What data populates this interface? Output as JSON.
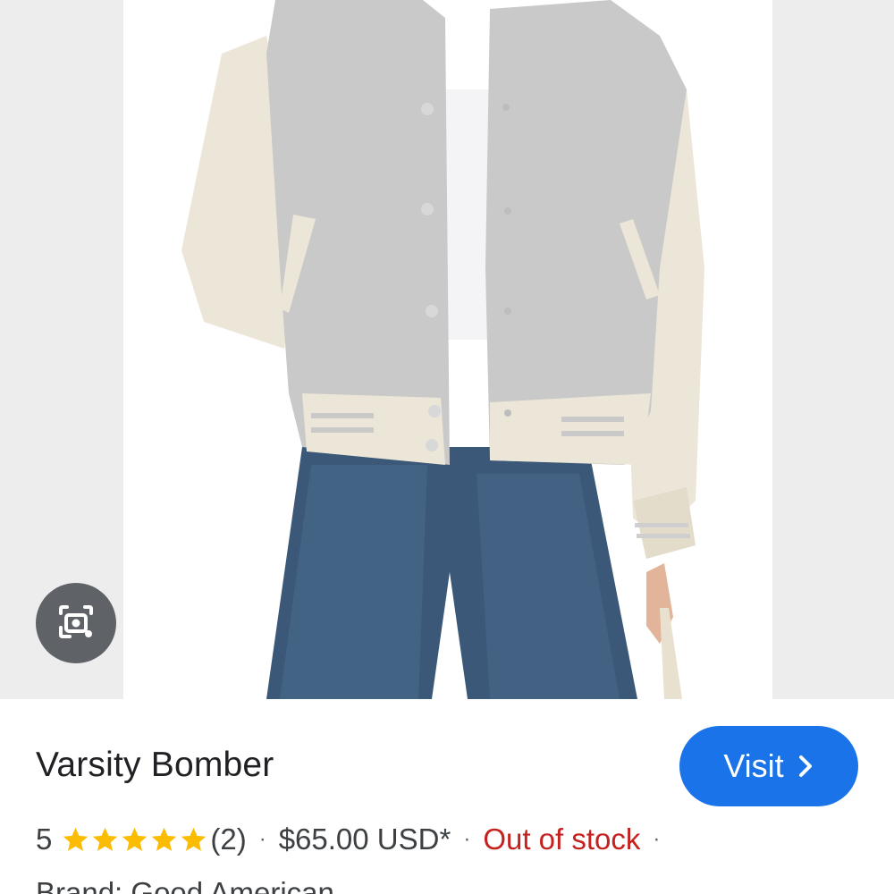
{
  "product": {
    "title": "Varsity Bomber",
    "rating": "5",
    "stars_filled": 5,
    "stars_total": 5,
    "review_count": "(2)",
    "price": "$65.00 USD*",
    "stock_status": "Out of stock",
    "separator": "·",
    "brand_line": "Brand: Good American"
  },
  "actions": {
    "visit_label": "Visit",
    "visit_icon": "chevron-right-icon",
    "lens_icon": "camera-search-icon"
  },
  "image": {
    "subject": "varsity-bomber-jacket-photo"
  },
  "colors": {
    "accent": "#1a73e8",
    "stock_out": "#c5221f",
    "star": "#fbbc04",
    "lens_bg": "#5f6368"
  }
}
